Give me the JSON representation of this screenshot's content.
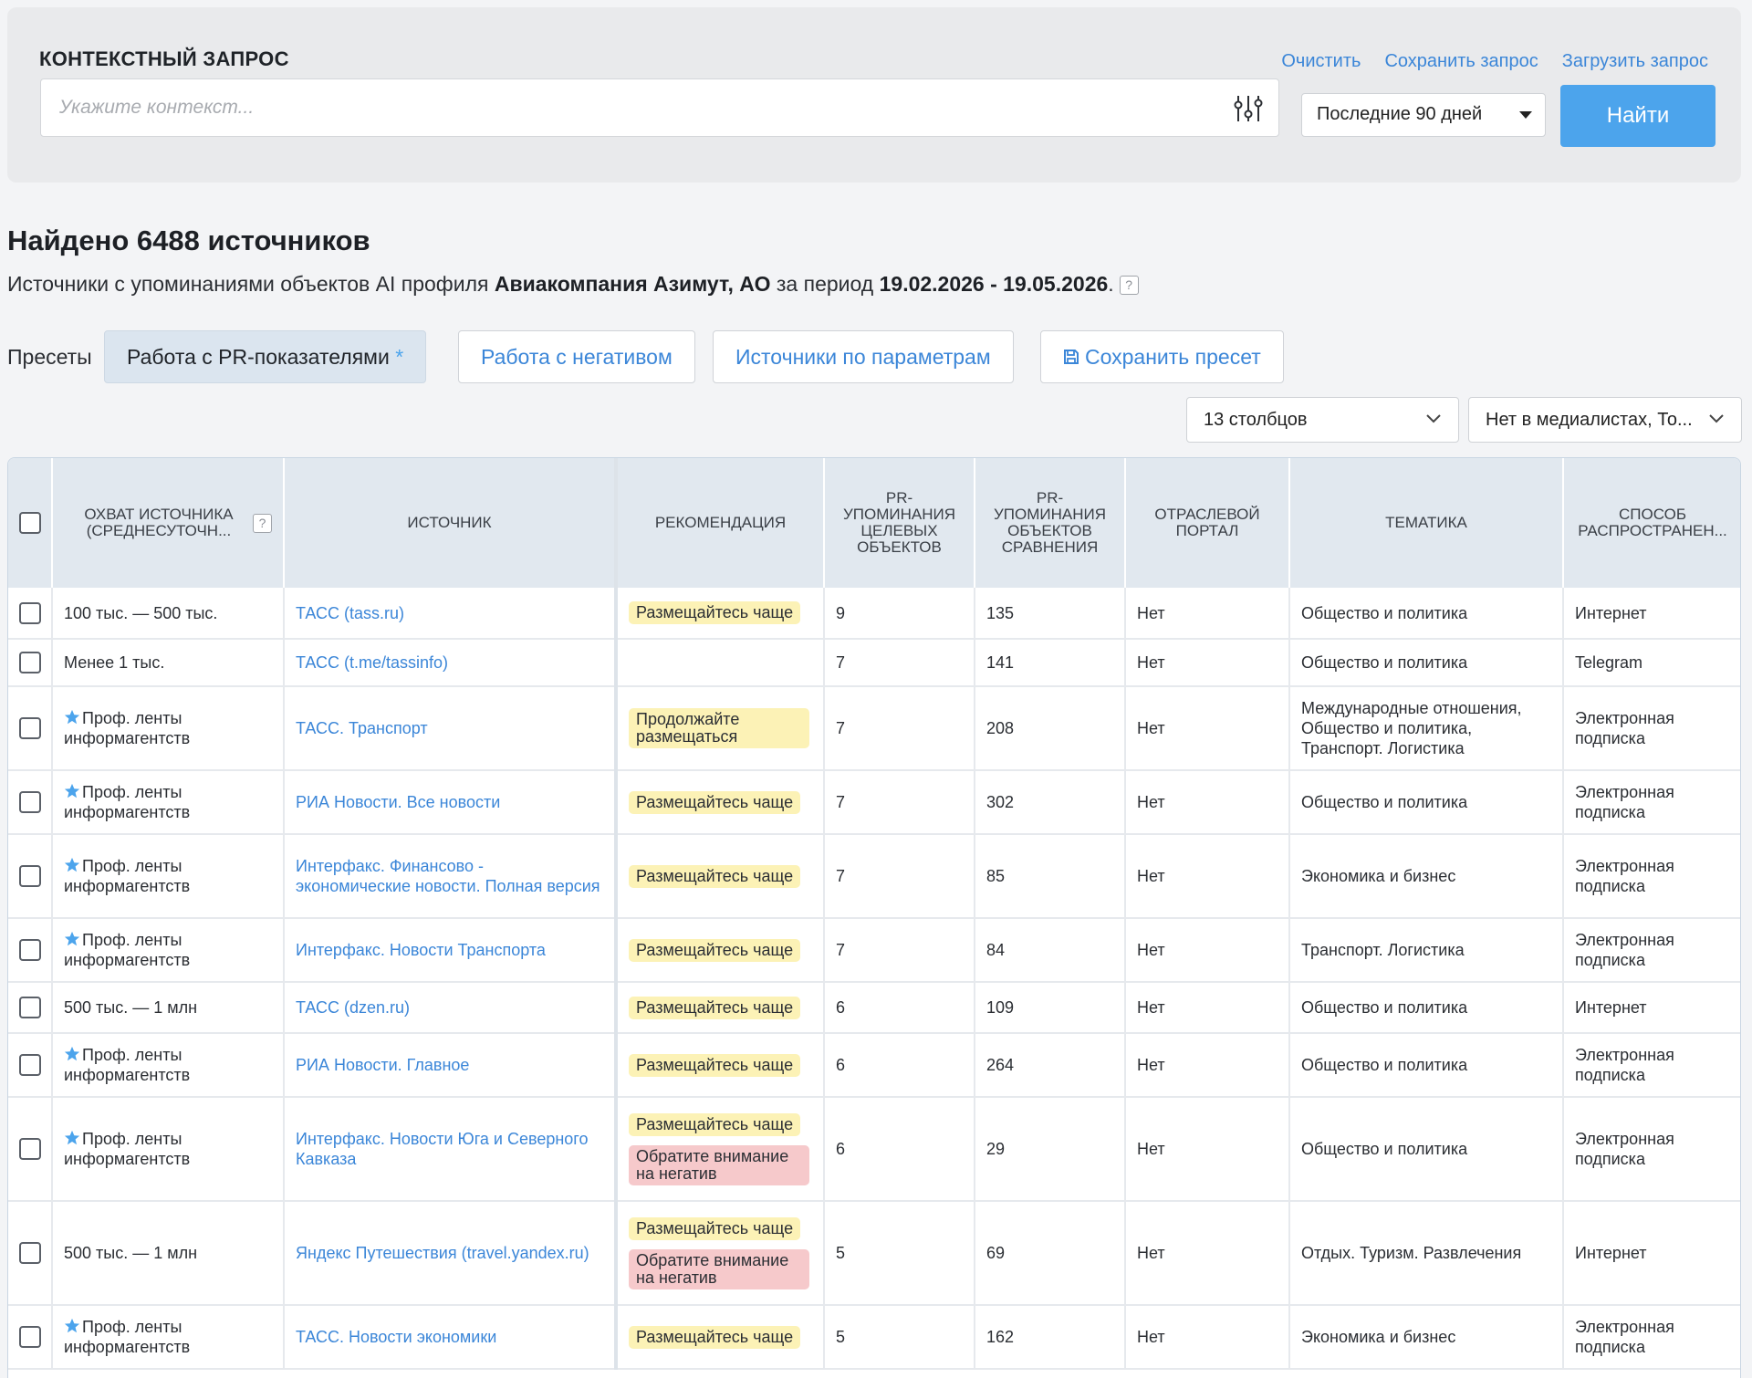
{
  "query": {
    "title": "КОНТЕКСТНЫЙ ЗАПРОС",
    "clear_label": "Очистить",
    "save_label": "Сохранить запрос",
    "load_label": "Загрузить запрос",
    "placeholder": "Укажите контекст...",
    "value": "",
    "period": "Последние 90 дней",
    "find_label": "Найти"
  },
  "results": {
    "title": "Найдено 6488 источников",
    "sub_prefix": "Источники с упоминаниями объектов AI профиля ",
    "profile": "Авиакомпания Азимут, АО",
    "sub_mid": " за период ",
    "period": "19.02.2026 - 19.05.2026",
    "sub_suffix": ".",
    "help": "?"
  },
  "presets": {
    "label": "Пресеты",
    "items": [
      {
        "label": "Работа с PR-показателями",
        "star": "*"
      },
      {
        "label": "Работа с негативом"
      },
      {
        "label": "Источники по параметрам"
      }
    ],
    "save_label": "Сохранить пресет"
  },
  "controls": {
    "columns": "13 столбцов",
    "filter": "Нет в медиалистах, То..."
  },
  "table": {
    "headers": {
      "reach": "Охват источника (среднесуточн...",
      "source": "Источник",
      "recommendation": "Рекомендация",
      "pr_target": "PR-упоминания целевых объектов",
      "pr_compare": "PR-упоминания объектов сравнения",
      "industry": "Отраслевой портал",
      "topic": "Тематика",
      "distribution": "Способ распространен..."
    },
    "help": "?",
    "rows": [
      {
        "star": false,
        "reach": "100 тыс. — 500 тыс.",
        "source": "ТАСС (tass.ru)",
        "rec1": "Размещайтесь чаще",
        "rec1_type": "yellow",
        "rec2": "",
        "pr_target": "9",
        "pr_compare": "135",
        "industry": "Нет",
        "topic": "Общество и политика",
        "distribution": "Интернет"
      },
      {
        "star": false,
        "reach": "Менее 1 тыс.",
        "source": "ТАСС (t.me/tassinfo)",
        "rec1": "",
        "rec1_type": "",
        "rec2": "",
        "pr_target": "7",
        "pr_compare": "141",
        "industry": "Нет",
        "topic": "Общество и политика",
        "distribution": "Telegram"
      },
      {
        "star": true,
        "reach": "Проф. ленты информагентств",
        "source": "ТАСС. Транспорт",
        "rec1": "Продолжайте размещаться",
        "rec1_type": "yellow",
        "rec2": "",
        "pr_target": "7",
        "pr_compare": "208",
        "industry": "Нет",
        "topic": "Международные отношения, Общество и политика, Транспорт. Логистика",
        "distribution": "Электронная подписка"
      },
      {
        "star": true,
        "reach": "Проф. ленты информагентств",
        "source": "РИА Новости. Все новости",
        "rec1": "Размещайтесь чаще",
        "rec1_type": "yellow",
        "rec2": "",
        "pr_target": "7",
        "pr_compare": "302",
        "industry": "Нет",
        "topic": "Общество и политика",
        "distribution": "Электронная подписка"
      },
      {
        "star": true,
        "reach": "Проф. ленты информагентств",
        "source": "Интерфакс. Финансово - экономические новости. Полная версия",
        "rec1": "Размещайтесь чаще",
        "rec1_type": "yellow",
        "rec2": "",
        "pr_target": "7",
        "pr_compare": "85",
        "industry": "Нет",
        "topic": "Экономика и бизнес",
        "distribution": "Электронная подписка"
      },
      {
        "star": true,
        "reach": "Проф. ленты информагентств",
        "source": "Интерфакс. Новости Транспорта",
        "rec1": "Размещайтесь чаще",
        "rec1_type": "yellow",
        "rec2": "",
        "pr_target": "7",
        "pr_compare": "84",
        "industry": "Нет",
        "topic": "Транспорт. Логистика",
        "distribution": "Электронная подписка"
      },
      {
        "star": false,
        "reach": "500 тыс. — 1 млн",
        "source": "ТАСС (dzen.ru)",
        "rec1": "Размещайтесь чаще",
        "rec1_type": "yellow",
        "rec2": "",
        "pr_target": "6",
        "pr_compare": "109",
        "industry": "Нет",
        "topic": "Общество и политика",
        "distribution": "Интернет"
      },
      {
        "star": true,
        "reach": "Проф. ленты информагентств",
        "source": "РИА Новости. Главное",
        "rec1": "Размещайтесь чаще",
        "rec1_type": "yellow",
        "rec2": "",
        "pr_target": "6",
        "pr_compare": "264",
        "industry": "Нет",
        "topic": "Общество и политика",
        "distribution": "Электронная подписка"
      },
      {
        "star": true,
        "reach": "Проф. ленты информагентств",
        "source": "Интерфакс. Новости Юга и Северного Кавказа",
        "rec1": "Размещайтесь чаще",
        "rec1_type": "yellow",
        "rec2": "Обратите внимание на негатив",
        "pr_target": "6",
        "pr_compare": "29",
        "industry": "Нет",
        "topic": "Общество и политика",
        "distribution": "Электронная подписка"
      },
      {
        "star": false,
        "reach": "500 тыс. — 1 млн",
        "source": "Яндекс Путешествия (travel.yandex.ru)",
        "rec1": "Размещайтесь чаще",
        "rec1_type": "yellow",
        "rec2": "Обратите внимание на негатив",
        "pr_target": "5",
        "pr_compare": "69",
        "industry": "Нет",
        "topic": "Отдых. Туризм. Развлечения",
        "distribution": "Интернет"
      },
      {
        "star": true,
        "reach": "Проф. ленты информагентств",
        "source": "ТАСС. Новости экономики",
        "rec1": "Размещайтесь чаще",
        "rec1_type": "yellow",
        "rec2": "",
        "pr_target": "5",
        "pr_compare": "162",
        "industry": "Нет",
        "topic": "Экономика и бизнес",
        "distribution": "Электронная подписка"
      }
    ]
  },
  "colors": {
    "accent": "#4ca4ec",
    "link": "#3b86d8",
    "badge_yellow": "#fcf2b6",
    "badge_red": "#f6c9cb",
    "star": "#4ca4ec"
  }
}
